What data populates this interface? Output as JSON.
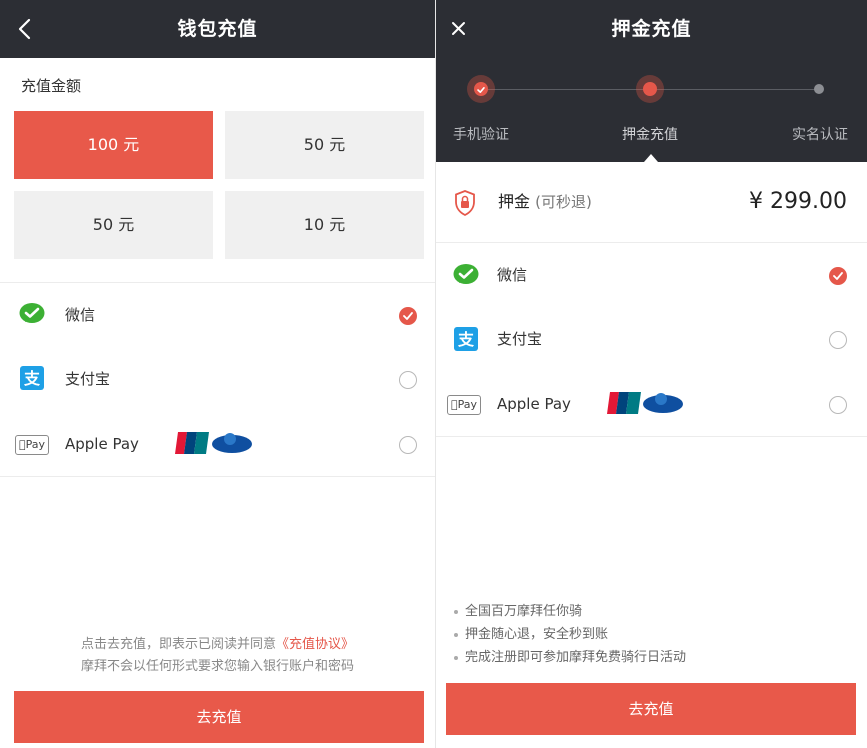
{
  "left": {
    "title": "钱包充值",
    "amount_label": "充值金额",
    "amounts": [
      {
        "label": "100 元",
        "selected": true
      },
      {
        "label": "50 元",
        "selected": false
      },
      {
        "label": "50 元",
        "selected": false
      },
      {
        "label": "10 元",
        "selected": false
      }
    ],
    "payments": [
      {
        "label": "微信",
        "icon": "wechat-icon",
        "checked": true
      },
      {
        "label": "支付宝",
        "icon": "alipay-icon",
        "checked": false
      },
      {
        "label": "Apple Pay",
        "icon": "apple-pay-icon",
        "badge": "Pay",
        "checked": false
      }
    ],
    "footnote_line1_prefix": "点击去充值，即表示已阅读并同意",
    "footnote_link": "《充值协议》",
    "footnote_line2": "摩拜不会以任何形式要求您输入银行账户和密码",
    "cta": "去充值"
  },
  "right": {
    "title": "押金充值",
    "steps": [
      "手机验证",
      "押金充值",
      "实名认证"
    ],
    "deposit_label": "押金",
    "deposit_note": "(可秒退)",
    "deposit_amount": "¥ 299.00",
    "payments": [
      {
        "label": "微信",
        "icon": "wechat-icon",
        "checked": true
      },
      {
        "label": "支付宝",
        "icon": "alipay-icon",
        "checked": false
      },
      {
        "label": "Apple Pay",
        "icon": "apple-pay-icon",
        "badge": "Pay",
        "checked": false
      }
    ],
    "bullets": [
      "全国百万摩拜任你骑",
      "押金随心退，安全秒到账",
      "完成注册即可参加摩拜免费骑行日活动"
    ],
    "cta": "去充值"
  },
  "colors": {
    "accent": "#e8594a",
    "topbar": "#2c2e34",
    "wechat": "#3cb034",
    "alipay": "#1ea0e6"
  }
}
